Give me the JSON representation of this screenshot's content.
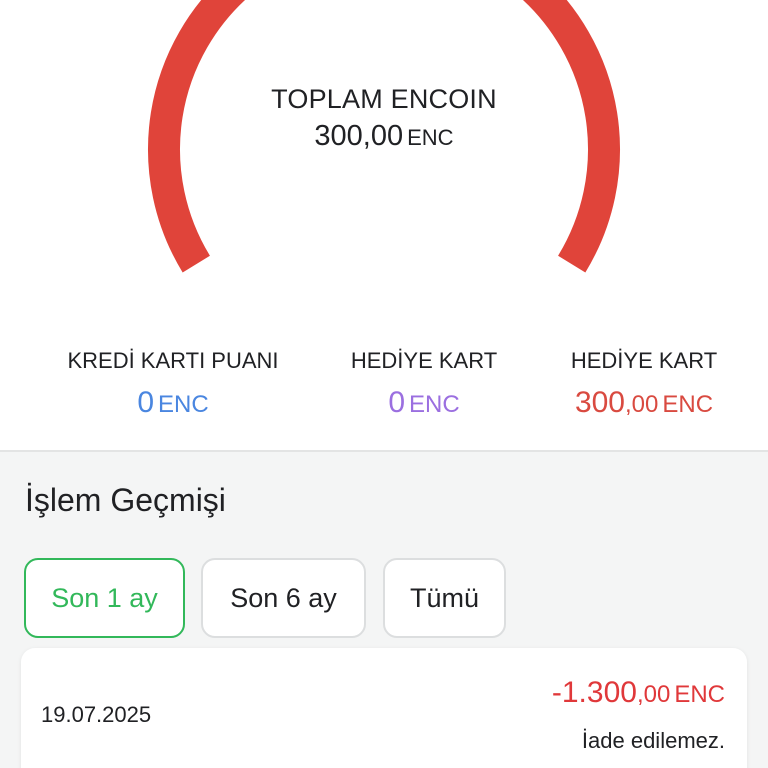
{
  "colors": {
    "accent_red": "#e0443a",
    "blue": "#4a86e0",
    "purple": "#9b6fe0",
    "red_text": "#d94a40",
    "green": "#32b85a"
  },
  "summary": {
    "title": "TOPLAM ENCOIN",
    "value": "300,00",
    "unit": "ENC"
  },
  "stats": [
    {
      "label": "KREDİ KARTI PUANI",
      "int": "0",
      "dec": "",
      "unit": "ENC"
    },
    {
      "label": "HEDİYE KART",
      "int": "0",
      "dec": "",
      "unit": "ENC"
    },
    {
      "label": "HEDİYE KART",
      "int": "300",
      "dec": ",00",
      "unit": "ENC"
    }
  ],
  "history": {
    "title": "İşlem Geçmişi",
    "filters": [
      "Son 1 ay",
      "Son 6 ay",
      "Tümü"
    ],
    "selected_filter": "Son 1 ay",
    "transactions": [
      {
        "date": "19.07.2025",
        "amount_int": "-1.300",
        "amount_dec": ",00",
        "unit": "ENC",
        "note": "İade edilemez."
      }
    ]
  }
}
